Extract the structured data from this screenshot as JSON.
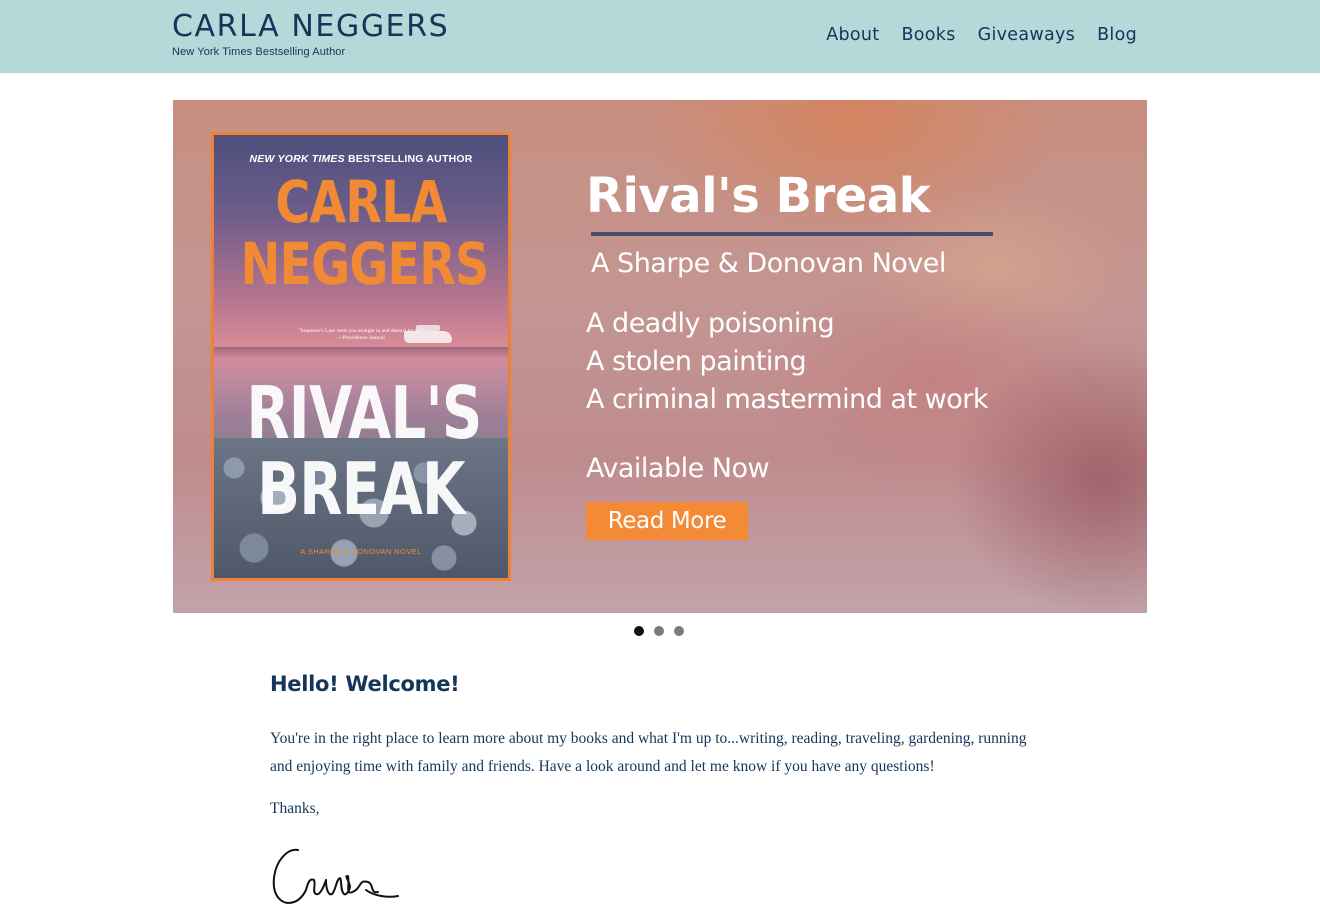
{
  "header": {
    "site_name": "CARLA NEGGERS",
    "tagline": "New York Times Bestselling Author",
    "nav": [
      "About",
      "Books",
      "Giveaways",
      "Blog"
    ]
  },
  "slider": {
    "cover": {
      "kicker_italic": "NEW YORK TIMES",
      "kicker_rest": " BESTSELLING AUTHOR",
      "author_line1": "CARLA",
      "author_line2": "NEGGERS",
      "quote": "\"Impostor's Lure reels you straight in and doesn't let go.\"",
      "quote_source": "—Providence Journal",
      "title_line1": "RIVAL'S",
      "title_line2": "BREAK",
      "series": "A SHARPE & DONOVAN NOVEL"
    },
    "title": "Rival's Break",
    "subtitle": "A Sharpe  & Donovan Novel",
    "lines": [
      "A deadly poisoning",
      "A stolen painting",
      "A criminal mastermind at work"
    ],
    "availability": "Available Now",
    "cta_label": "Read More",
    "active_slide": 1,
    "slide_count": 3
  },
  "welcome": {
    "heading": "Hello! Welcome!",
    "intro": "You're in the right place to learn more about my books and what I'm up to...writing, reading, traveling, gardening, running and enjoying time with family and friends. Have a look around and let me know if you have any questions!",
    "signoff": "Thanks,",
    "signature": "Carla"
  },
  "colors": {
    "header_bg": "#b3d9d8",
    "brand_navy": "#13365a",
    "accent_orange": "#f48a35",
    "rule_color": "#454d70"
  }
}
